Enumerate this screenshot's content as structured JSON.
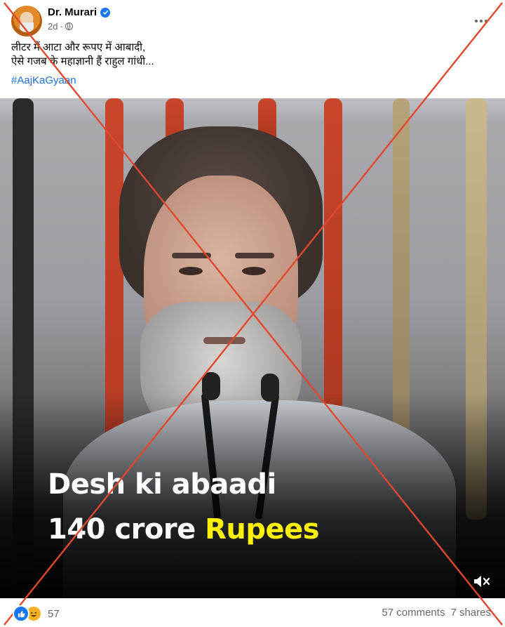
{
  "author": {
    "name": "Dr. Murari",
    "time": "2d",
    "separator": "·"
  },
  "post": {
    "line1": "लीटर में आटा और रूपए में आबादी,",
    "line2": "ऐसे गजब के महाज्ञानी हैं राहुल गांधी...",
    "hashtag": "#AajKaGyaan"
  },
  "video": {
    "caption_line1": "Desh ki abaadi",
    "caption_line2_part1": "140 crore ",
    "caption_line2_part2": "Rupees"
  },
  "footer": {
    "reaction_count": "57",
    "comments": "57 comments",
    "shares": "7 shares"
  },
  "colors": {
    "cross": "#e2482f",
    "caption_highlight": "#fff200",
    "verified": "#1877f2",
    "hashtag": "#216fdb"
  },
  "icons": [
    "verified-icon",
    "globe-icon",
    "more-icon",
    "mute-icon",
    "like-reaction-icon",
    "haha-reaction-icon"
  ]
}
